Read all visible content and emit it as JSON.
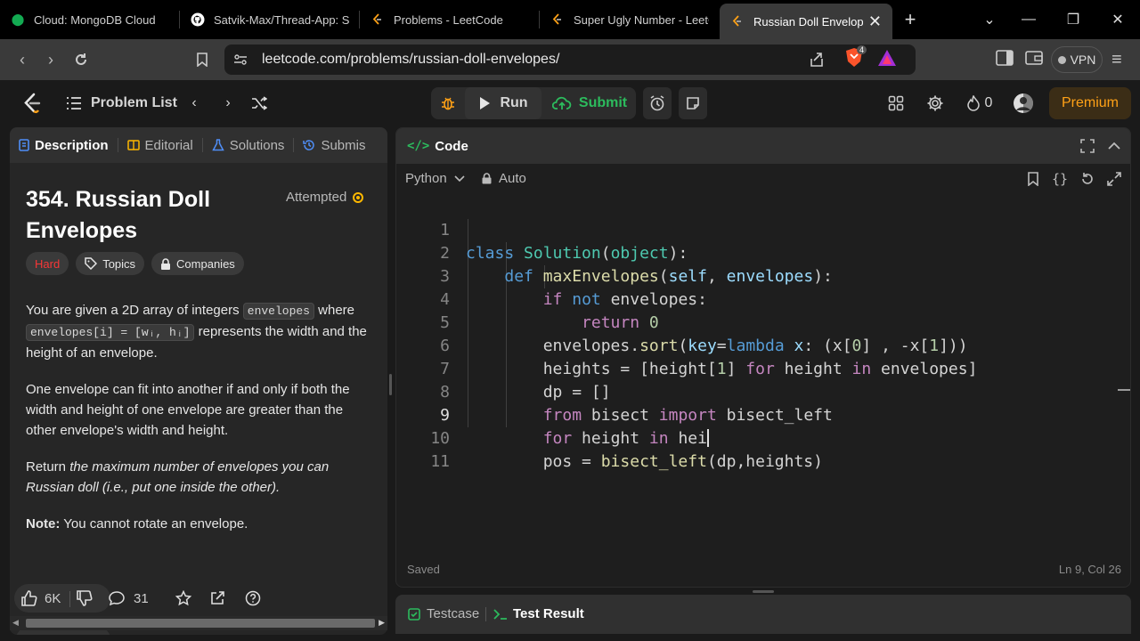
{
  "browser": {
    "tabs": [
      {
        "title": "Cloud: MongoDB Cloud",
        "icon": "mongodb-leaf-icon"
      },
      {
        "title": "Satvik-Max/Thread-App: Sin",
        "icon": "github-icon"
      },
      {
        "title": "Problems - LeetCode",
        "icon": "leetcode-icon"
      },
      {
        "title": "Super Ugly Number - LeetC",
        "icon": "leetcode-icon"
      },
      {
        "title": "Russian Doll Envelopes",
        "icon": "leetcode-icon",
        "active": true
      }
    ],
    "url": "leetcode.com/problems/russian-doll-envelopes/",
    "shield_count": "4",
    "vpn_label": "VPN"
  },
  "topnav": {
    "problem_list_label": "Problem List",
    "run_label": "Run",
    "submit_label": "Submit",
    "streak_count": "0",
    "premium_label": "Premium"
  },
  "left": {
    "tabs": [
      "Description",
      "Editorial",
      "Solutions",
      "Submis"
    ],
    "title": "354. Russian Doll Envelopes",
    "status": "Attempted",
    "difficulty": "Hard",
    "topics_label": "Topics",
    "companies_label": "Companies",
    "desc": {
      "p1_a": "You are given a 2D array of integers ",
      "p1_code1": "envelopes",
      "p1_b": " where ",
      "p1_code2": "envelopes[i] = [wᵢ, hᵢ]",
      "p1_c": " represents the width and the height of an envelope.",
      "p2": "One envelope can fit into another if and only if both the width and height of one envelope are greater than the other envelope's width and height.",
      "p3_a": "Return ",
      "p3_b": "the maximum number of envelopes you can Russian doll (i.e., put one inside the other).",
      "note_label": "Note:",
      "note_text": " You cannot rotate an envelope."
    },
    "footer": {
      "likes": "6K",
      "comments": "31"
    }
  },
  "right": {
    "header_label": "Code",
    "language": "Python",
    "format_label": "Auto",
    "status_left": "Saved",
    "status_right": "Ln 9, Col 26",
    "line_numbers": [
      "1",
      "2",
      "3",
      "4",
      "5",
      "6",
      "7",
      "8",
      "9",
      "10",
      "11"
    ],
    "code_lines": [
      "class Solution(object):",
      "    def maxEnvelopes(self, envelopes):",
      "        if not envelopes:",
      "            return 0",
      "        envelopes.sort(key=lambda x: (x[0] , -x[1]))",
      "        heights = [height[1] for height in envelopes]",
      "        dp = []",
      "        from bisect import bisect_left",
      "        for height in hei",
      "        pos = bisect_left(dp,heights)",
      ""
    ]
  },
  "bottom": {
    "testcase_label": "Testcase",
    "result_label": "Test Result"
  },
  "colors": {
    "accent_green": "#2cbb5d",
    "premium_orange": "#ffa116",
    "hard_red": "#f63737"
  }
}
